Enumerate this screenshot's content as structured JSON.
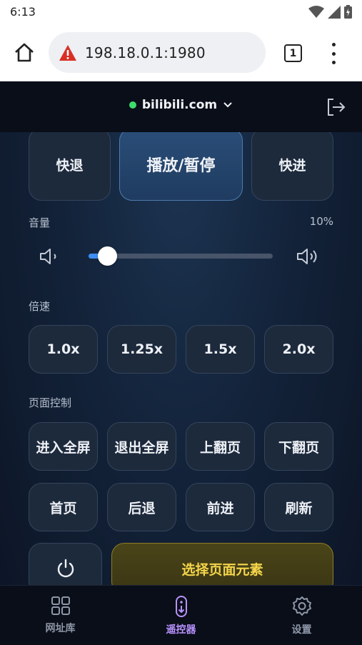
{
  "status_bar": {
    "time": "6:13"
  },
  "browser": {
    "url": "198.18.0.1:1980",
    "tab_count": "1"
  },
  "header": {
    "site": "bilibili.com"
  },
  "playback": {
    "rewind": "快退",
    "play_pause": "播放/暂停",
    "forward": "快进"
  },
  "volume": {
    "label": "音量",
    "percent_text": "10%",
    "level": 0.1
  },
  "speed": {
    "label": "倍速",
    "options": [
      "1.0x",
      "1.25x",
      "1.5x",
      "2.0x"
    ]
  },
  "page_control": {
    "label": "页面控制",
    "row1": [
      "进入全屏",
      "退出全屏",
      "上翻页",
      "下翻页"
    ],
    "row2": [
      "首页",
      "后退",
      "前进",
      "刷新"
    ],
    "select_element": "选择页面元素"
  },
  "bottom_nav": {
    "items": [
      {
        "label": "网址库",
        "icon": "grid-icon"
      },
      {
        "label": "遥控器",
        "icon": "remote-icon",
        "active": true
      },
      {
        "label": "设置",
        "icon": "gear-icon"
      }
    ]
  },
  "colors": {
    "accent": "#3f8ef5",
    "active_tab": "#b892ff",
    "online_dot": "#3ddc6e",
    "gold_text": "#f5d54a"
  }
}
